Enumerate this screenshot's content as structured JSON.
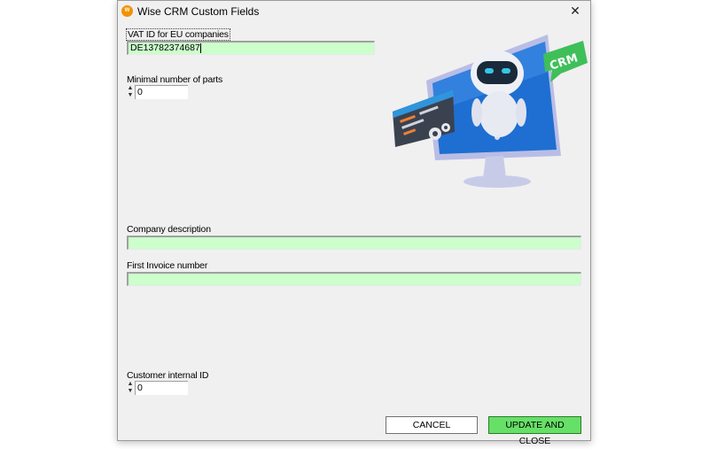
{
  "window": {
    "title": "Wise CRM Custom Fields",
    "icon_text": "W",
    "icon_color": "#f29200",
    "close_glyph": "✕"
  },
  "fields": {
    "vat": {
      "label": "VAT ID for EU companies",
      "value": "DE13782374687"
    },
    "min_parts": {
      "label": "Minimal number of parts",
      "value": "0"
    },
    "company_description": {
      "label": "Company description",
      "value": ""
    },
    "first_invoice": {
      "label": "First Invoice number",
      "value": ""
    },
    "customer_id": {
      "label": "Customer internal ID",
      "value": "0"
    }
  },
  "illustration": {
    "badge_text": "CRM",
    "icon": "robot-crm-illustration"
  },
  "buttons": {
    "cancel": "CANCEL",
    "update": "UPDATE AND CLOSE"
  },
  "colors": {
    "input_bg": "#ccffcc",
    "update_button": "#66e066",
    "window_bg": "#f0f0f0"
  }
}
